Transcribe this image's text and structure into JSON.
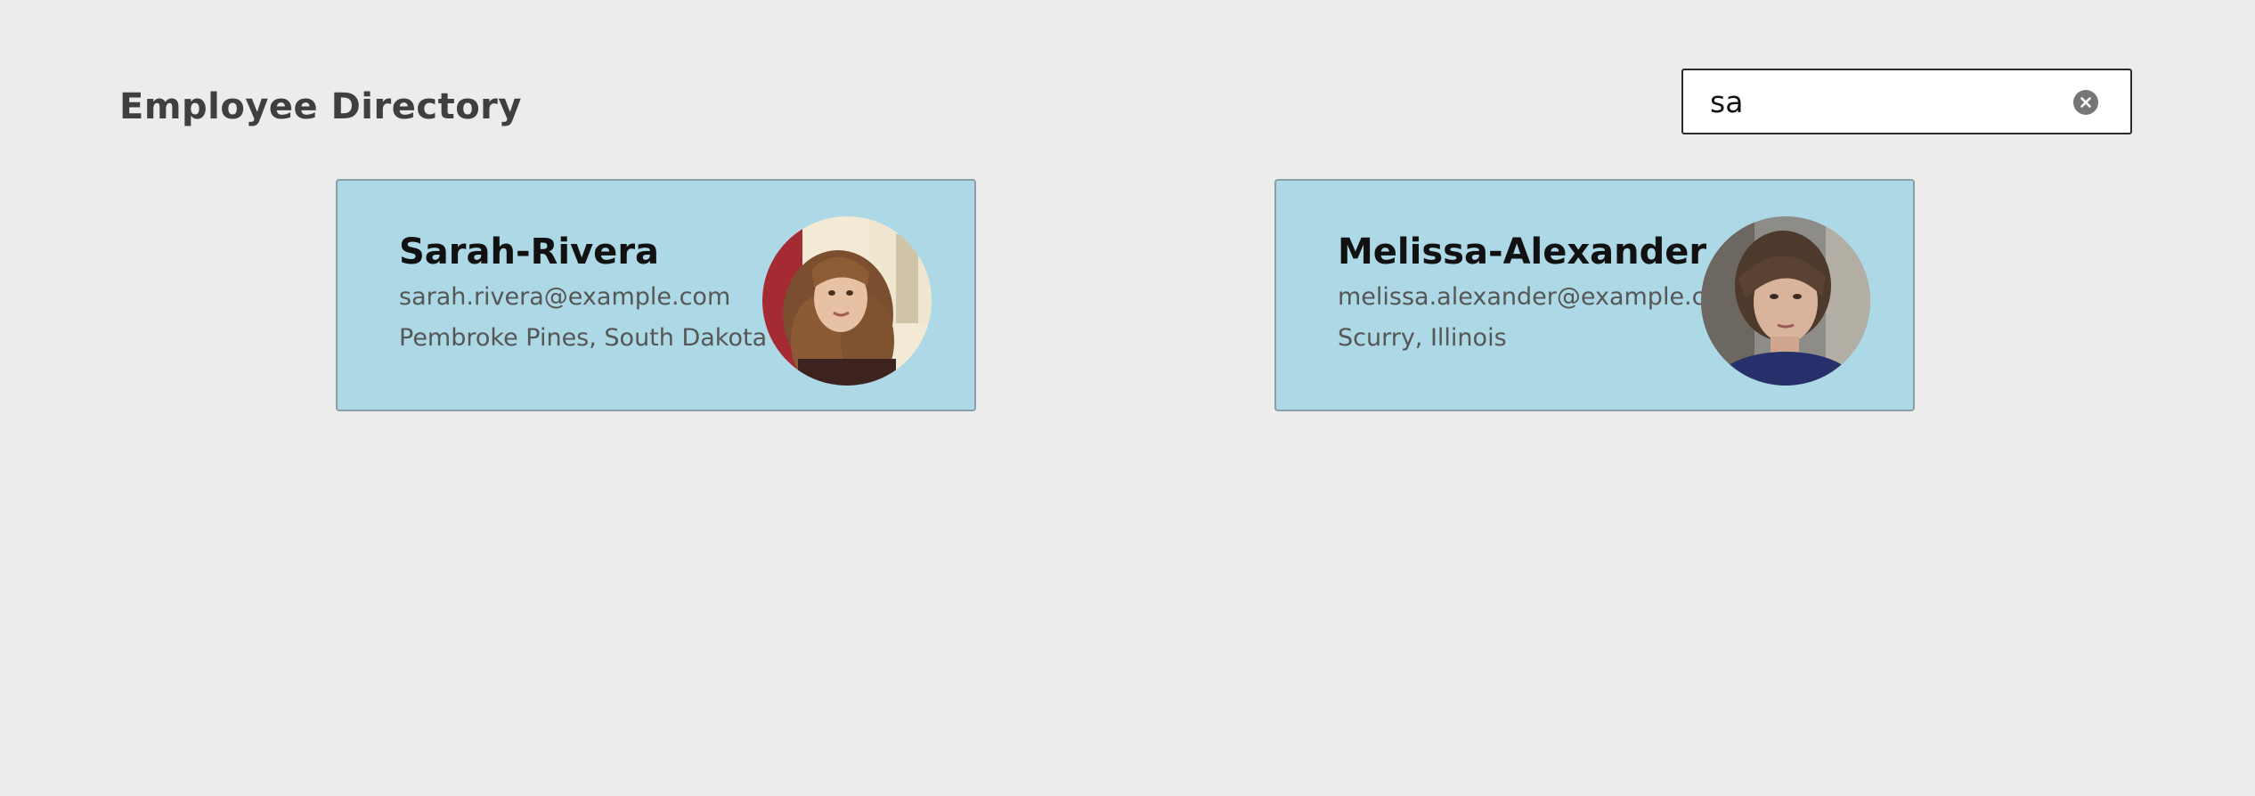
{
  "header": {
    "title": "Employee Directory"
  },
  "search": {
    "value": "sa",
    "clear_icon": "clear-circle-icon"
  },
  "employees": [
    {
      "name": "Sarah-Rivera",
      "email": "sarah.rivera@example.com",
      "location": "Pembroke Pines, South Dakota"
    },
    {
      "name": "Melissa-Alexander",
      "email": "melissa.alexander@example.com",
      "location": "Scurry, Illinois"
    }
  ],
  "colors": {
    "background": "#ececec",
    "card": "#add8e6",
    "card_border": "#8a9fa8"
  }
}
